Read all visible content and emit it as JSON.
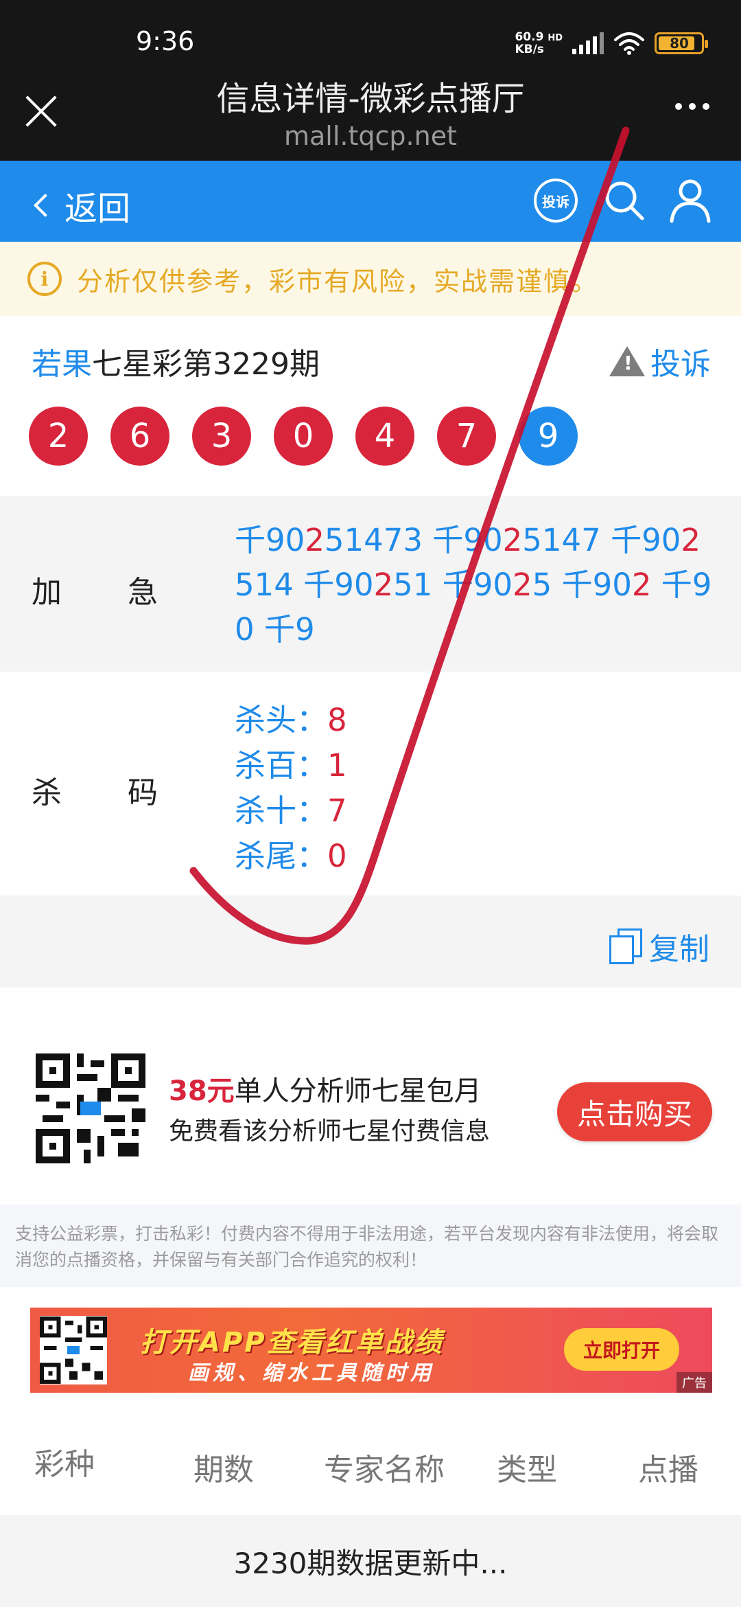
{
  "status": {
    "time": "9:36",
    "net_speed_value": "60.9",
    "net_speed_unit": "KB/s",
    "network_type": "HD",
    "battery": "80"
  },
  "browser": {
    "title": "信息详情-微彩点播厅",
    "url": "mall.tqcp.net"
  },
  "nav": {
    "back_label": "返回",
    "complain_badge": "投诉"
  },
  "notice": {
    "icon_char": "i",
    "text": "分析仅供参考，彩市有风险，实战需谨慎。"
  },
  "draw": {
    "author": "若果",
    "title": "七星彩第3229期",
    "report_label": "投诉",
    "report_icon_char": "!",
    "balls": [
      {
        "n": "2",
        "color": "red"
      },
      {
        "n": "6",
        "color": "red"
      },
      {
        "n": "3",
        "color": "red"
      },
      {
        "n": "0",
        "color": "red"
      },
      {
        "n": "4",
        "color": "red"
      },
      {
        "n": "7",
        "color": "red"
      },
      {
        "n": "9",
        "color": "blue"
      }
    ]
  },
  "urgent": {
    "label_a": "加",
    "label_b": "急",
    "items": [
      {
        "pre": "千90",
        "hl": "2",
        "post": "51473"
      },
      {
        "pre": "千90",
        "hl": "2",
        "post": "5147"
      },
      {
        "pre": "千90",
        "hl": "2",
        "post": "514"
      },
      {
        "pre": "千90",
        "hl": "2",
        "post": "51"
      },
      {
        "pre": "千90",
        "hl": "2",
        "post": "5"
      },
      {
        "pre": "千90",
        "hl": "2",
        "post": ""
      },
      {
        "pre": "千90",
        "hl": "",
        "post": ""
      },
      {
        "pre": "千9",
        "hl": "",
        "post": ""
      }
    ]
  },
  "kill": {
    "label_a": "杀",
    "label_b": "码",
    "items": [
      {
        "k": "杀头：",
        "v": "8"
      },
      {
        "k": "杀百：",
        "v": "1"
      },
      {
        "k": "杀十：",
        "v": "7"
      },
      {
        "k": "杀尾：",
        "v": "0"
      }
    ]
  },
  "copy": {
    "label": "复制"
  },
  "subscription": {
    "price": "38元",
    "title": "单人分析师七星包月",
    "desc": "免费看该分析师七星付费信息",
    "button": "点击购买"
  },
  "disclaimer": "支持公益彩票，打击私彩！付费内容不得用于非法用途，若平台发现内容有非法使用，将会取消您的点播资格，并保留与有关部门合作追究的权利！",
  "banner": {
    "title": "打开APP查看红单战绩",
    "subtitle": "画规、缩水工具随时用",
    "button": "立即打开",
    "ad_tag": "广告"
  },
  "table": {
    "headers": [
      "彩种",
      "期数",
      "专家名称",
      "类型",
      "点播"
    ],
    "loading": "3230期数据更新中..."
  },
  "colors": {
    "brand_blue": "#1f8bea",
    "ball_red": "#d8253c",
    "notice_orange": "#e5a925",
    "annotation_red": "#c8102e"
  }
}
